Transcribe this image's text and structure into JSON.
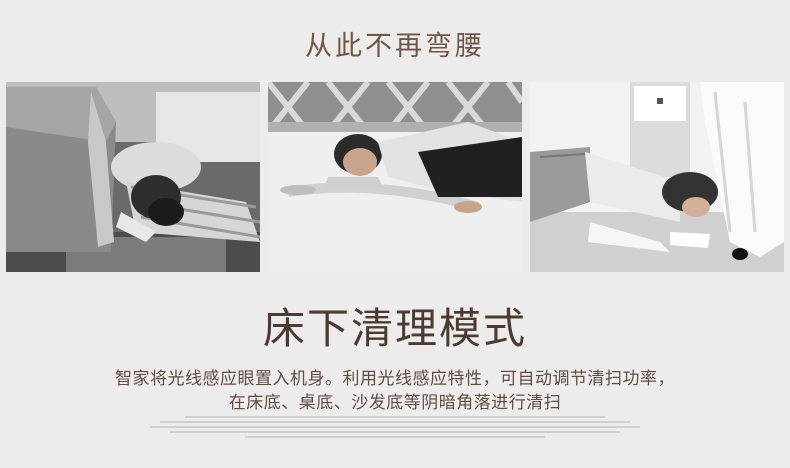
{
  "heading": {
    "top": "从此不再弯腰",
    "mode": "床下清理模式"
  },
  "description": {
    "line1": "智家将光线感应眼置入机身。利用光线感应特性，可自动调节清扫功率，",
    "line2": "在床底、桌底、沙发底等阴暗角落进行清扫"
  },
  "photos": [
    {
      "icon": "person-crawling-under-bed-photo"
    },
    {
      "icon": "person-cleaning-floor-photo"
    },
    {
      "icon": "person-kneeling-at-bed-photo"
    }
  ],
  "colors": {
    "background": "#eeeceb",
    "title": "#6e5549",
    "mode_title": "#4a3a33",
    "text": "#5f4d44"
  }
}
